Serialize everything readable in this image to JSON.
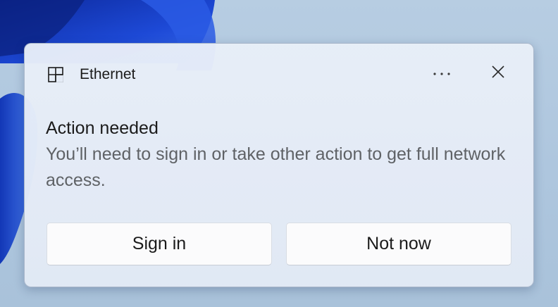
{
  "notification": {
    "app_name": "Ethernet",
    "app_icon": "network-icon",
    "title": "Action needed",
    "body": "You’ll need to sign in or take other action to get full network access.",
    "more_icon": "more-options-icon",
    "close_icon": "close-icon"
  },
  "buttons": {
    "sign_in": "Sign in",
    "not_now": "Not now"
  },
  "colors": {
    "wallpaper": "#aec6de",
    "wallpaper_bloom": "#1a3fc4",
    "toast_background": "#e4ebf6",
    "button_background": "#fbfbfc",
    "body_text": "#5f6266"
  }
}
